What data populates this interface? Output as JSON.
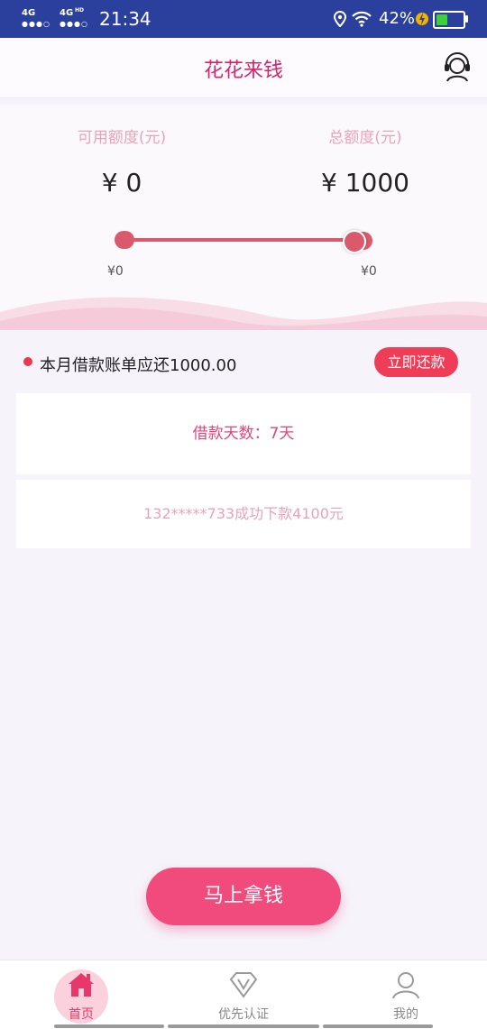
{
  "status_bar": {
    "network_1": "4G",
    "network_2": "4G",
    "network_2_sup": "HD",
    "time": "21:34",
    "battery_percent": "42%",
    "battery_level": 0.42
  },
  "header": {
    "title": "花花来钱"
  },
  "credit": {
    "available_label": "可用额度(元)",
    "available_amount": "¥ 0",
    "total_label": "总额度(元)",
    "total_amount": "¥ 1000",
    "slider_min": "¥0",
    "slider_max": "¥0"
  },
  "bill": {
    "text": "本月借款账单应还1000.00",
    "repay_button": "立即还款"
  },
  "cards": {
    "loan_days": "借款天数：7天",
    "notice": "132*****733成功下款4100元"
  },
  "main_button": "马上拿钱",
  "tabs": [
    {
      "label": "首页",
      "active": true
    },
    {
      "label": "优先认证",
      "active": false
    },
    {
      "label": "我的",
      "active": false
    }
  ],
  "colors": {
    "accent": "#f14a7d",
    "title": "#d6246c",
    "status_bar": "#2b3f9c"
  }
}
